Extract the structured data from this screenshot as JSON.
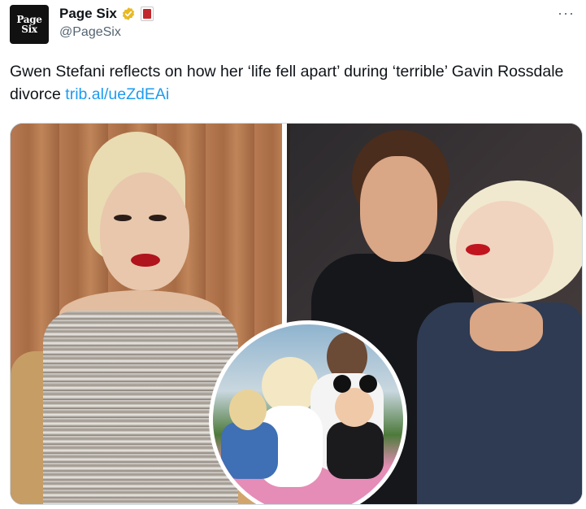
{
  "account": {
    "display_name": "Page Six",
    "handle": "@PageSix",
    "avatar_line1": "Page",
    "avatar_line2": "Six",
    "verified_color": "#e8b923"
  },
  "tweet": {
    "text": "Gwen Stefani reflects on how her ‘life fell apart’ during ‘terrible’ Gavin Rossdale divorce ",
    "link": "trib.al/ueZdEAi",
    "more_label": "···"
  },
  "media": {
    "icon": "photo-collage"
  },
  "colors": {
    "link": "#1d9bf0",
    "secondary_text": "#536471"
  }
}
